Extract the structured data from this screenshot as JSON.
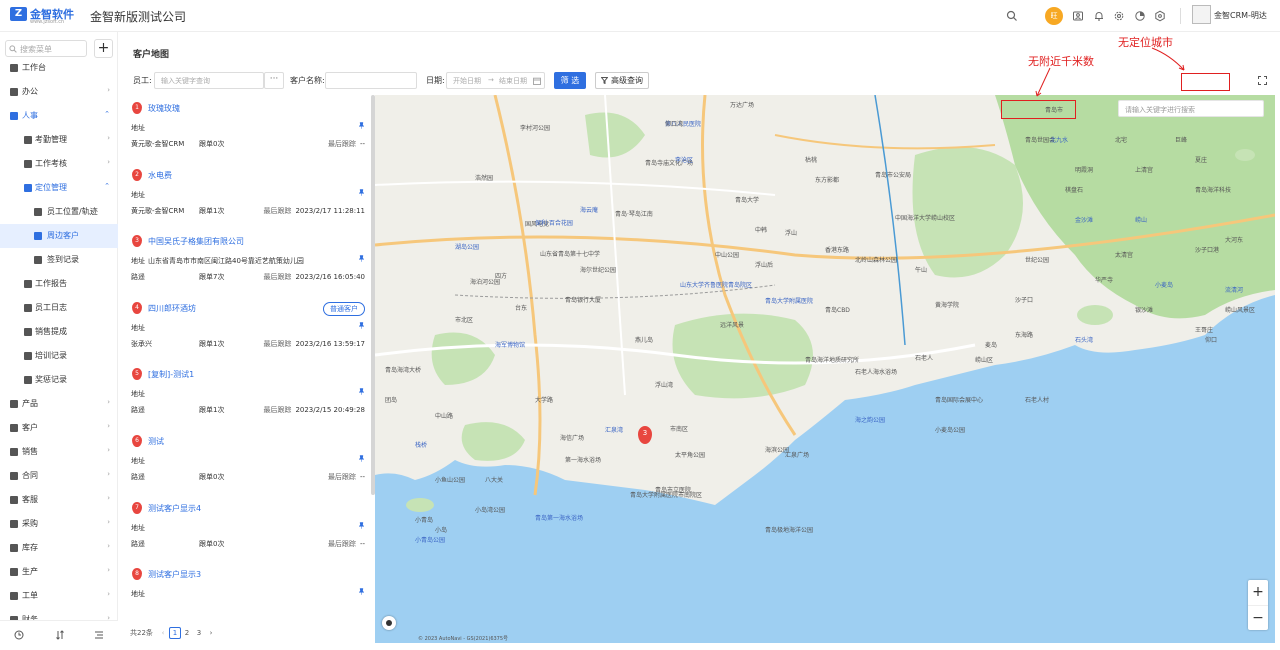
{
  "header": {
    "logo_name": "金智软件",
    "logo_url": "www.jzsoft.cn",
    "company": "金智新版测试公司",
    "highlight_icon_text": "旺",
    "user_name": "金智CRM-明达"
  },
  "sidebar": {
    "search_placeholder": "搜索菜单",
    "plus": "+",
    "items": [
      {
        "label": "工作台",
        "icon": "dashboard-icon"
      },
      {
        "label": "办公",
        "icon": "office-icon",
        "arrow": "›"
      },
      {
        "label": "人事",
        "icon": "people-icon",
        "arrow": "⌃"
      },
      {
        "label": "考勤管理",
        "icon": "folder-icon",
        "arrow": "›"
      },
      {
        "label": "工作考核",
        "icon": "folder-icon",
        "arrow": "›"
      },
      {
        "label": "定位管理",
        "icon": "folder-icon",
        "arrow": "⌃"
      },
      {
        "label": "员工位置/轨迹",
        "icon": "location-icon"
      },
      {
        "label": "周边客户",
        "icon": "nearby-icon"
      },
      {
        "label": "签到记录",
        "icon": "checkin-icon"
      },
      {
        "label": "工作报告",
        "icon": "report-icon"
      },
      {
        "label": "员工日志",
        "icon": "log-icon"
      },
      {
        "label": "销售提成",
        "icon": "commission-icon"
      },
      {
        "label": "培训记录",
        "icon": "training-icon"
      },
      {
        "label": "奖惩记录",
        "icon": "award-icon"
      },
      {
        "label": "产品",
        "icon": "product-icon",
        "arrow": "›"
      },
      {
        "label": "客户",
        "icon": "customer-icon",
        "arrow": "›"
      },
      {
        "label": "销售",
        "icon": "sales-icon",
        "arrow": "›"
      },
      {
        "label": "合同",
        "icon": "contract-icon",
        "arrow": "›"
      },
      {
        "label": "客服",
        "icon": "service-icon",
        "arrow": "›"
      },
      {
        "label": "采购",
        "icon": "purchase-icon",
        "arrow": "›"
      },
      {
        "label": "库存",
        "icon": "inventory-icon",
        "arrow": "›"
      },
      {
        "label": "生产",
        "icon": "production-icon",
        "arrow": "›"
      },
      {
        "label": "工单",
        "icon": "workorder-icon",
        "arrow": "›"
      },
      {
        "label": "财务",
        "icon": "finance-icon",
        "arrow": "›"
      }
    ]
  },
  "page": {
    "title": "客户地图"
  },
  "filters": {
    "employee_label": "员工:",
    "employee_placeholder": "输入关键字查询",
    "more": "···",
    "customer_label": "客户名称:",
    "date_label": "日期:",
    "start_placeholder": "开始日期",
    "range_sep": "→",
    "end_placeholder": "结束日期",
    "filter_button": "筛 选",
    "advanced_button": "高级查询"
  },
  "customers": [
    {
      "num": "1",
      "name": "玫瑰玫瑰",
      "addr_label": "地址",
      "addr": "",
      "owner": "黄元歌-金智CRM",
      "follow": "跟单0次",
      "last_label": "最后跟踪",
      "last": "--",
      "tag": ""
    },
    {
      "num": "2",
      "name": "水电费",
      "addr_label": "地址",
      "addr": "",
      "owner": "黄元歌-金智CRM",
      "follow": "跟单1次",
      "last_label": "最后跟踪",
      "last": "2023/2/17 11:28:11",
      "tag": ""
    },
    {
      "num": "3",
      "name": "中国吴氏子格集团有限公司",
      "addr_label": "地址",
      "addr": "山东省青岛市市南区闽江路40号靠近艺航策幼儿园",
      "owner": "路遥",
      "follow": "跟单7次",
      "last_label": "最后跟踪",
      "last": "2023/2/16 16:05:40",
      "tag": ""
    },
    {
      "num": "4",
      "name": "四川郎环酒坊",
      "addr_label": "地址",
      "addr": "",
      "owner": "张承兴",
      "follow": "跟单1次",
      "last_label": "最后跟踪",
      "last": "2023/2/16 13:59:17",
      "tag": "普通客户"
    },
    {
      "num": "5",
      "name": "[复制]-测试1",
      "addr_label": "地址",
      "addr": "",
      "owner": "路遥",
      "follow": "跟单1次",
      "last_label": "最后跟踪",
      "last": "2023/2/15 20:49:28",
      "tag": ""
    },
    {
      "num": "6",
      "name": "测试",
      "addr_label": "地址",
      "addr": "",
      "owner": "路遥",
      "follow": "跟单0次",
      "last_label": "最后跟踪",
      "last": "--",
      "tag": ""
    },
    {
      "num": "7",
      "name": "测试客户显示4",
      "addr_label": "地址",
      "addr": "",
      "owner": "路遥",
      "follow": "跟单0次",
      "last_label": "最后跟踪",
      "last": "--",
      "tag": ""
    },
    {
      "num": "8",
      "name": "测试客户显示3",
      "addr_label": "地址",
      "addr": "",
      "owner": "",
      "follow": "",
      "last_label": "",
      "last": "",
      "tag": ""
    }
  ],
  "pagination": {
    "total": "共22条",
    "prev": "‹",
    "pages": [
      "1",
      "2",
      "3"
    ],
    "next": "›"
  },
  "map": {
    "search_placeholder": "请输入关键字进行搜索",
    "marker": "3",
    "zoom_in": "+",
    "zoom_out": "−",
    "copyright": "© 2023 AutoNavi - GS(2021)6375号",
    "labels": [
      "第八人民医院",
      "青岛寺庙文化广场",
      "万达广场",
      "李村河公园",
      "浩然园",
      "海云庵",
      "青岛·琴岛江南",
      "中国海洋大学崂山校区",
      "国风电竞",
      "青岛大学",
      "保利·百合花园",
      "山东省青岛第十七中学",
      "海尔世纪公园",
      "中山公园",
      "北岭山森林公园",
      "湖岛公园",
      "四方",
      "海泊河公园",
      "台东",
      "青岛银行大厦",
      "山东大学齐鲁医院青岛院区",
      "远洋风景",
      "青岛市公安局",
      "浮山",
      "中韩",
      "青岛大学附属医院",
      "黄海学院",
      "石老人",
      "青岛海洋地质研究所",
      "海信广场",
      "汇泉湾",
      "八大关",
      "小鱼山公园",
      "大学路",
      "中山路",
      "栈桥",
      "小青岛",
      "浮山湾",
      "市南区",
      "崂山区",
      "李沧区",
      "市北区",
      "海滨公园",
      "青岛大学附属医院市南院区",
      "青岛市立医院",
      "青岛第一海水浴场",
      "石老人海水浴场",
      "青岛世园会",
      "午山",
      "沙子口",
      "崂山",
      "麦岛",
      "太平角公园",
      "小岛湾公园",
      "汇泉广场",
      "海军博物馆",
      "第一海水浴场",
      "青岛国际会展中心",
      "东海路",
      "青岛CBD",
      "海之韵公园",
      "枯桃",
      "青岛极地海洋公园",
      "香港东路",
      "燕儿岛",
      "石头湾",
      "青岛海湾大桥",
      "浮山后",
      "夏庄",
      "世纪公园",
      "金沙滩",
      "银沙滩",
      "东方影都",
      "小麦岛公园",
      "团岛",
      "小青岛公园",
      "小岛",
      "王哥庄",
      "北宅",
      "沙子口港",
      "流清河",
      "仰口",
      "大河东",
      "石老人村",
      "青岛海洋科技",
      "小麦岛",
      "崂山风景区",
      "太清宫",
      "上清宫",
      "明霞洞",
      "北九水",
      "华严寺",
      "棋盘石",
      "巨峰",
      "仰口湾"
    ]
  },
  "annotations": {
    "no_city": "无定位城市",
    "no_km": "无附近千米数",
    "nearby_label": "青岛市"
  }
}
